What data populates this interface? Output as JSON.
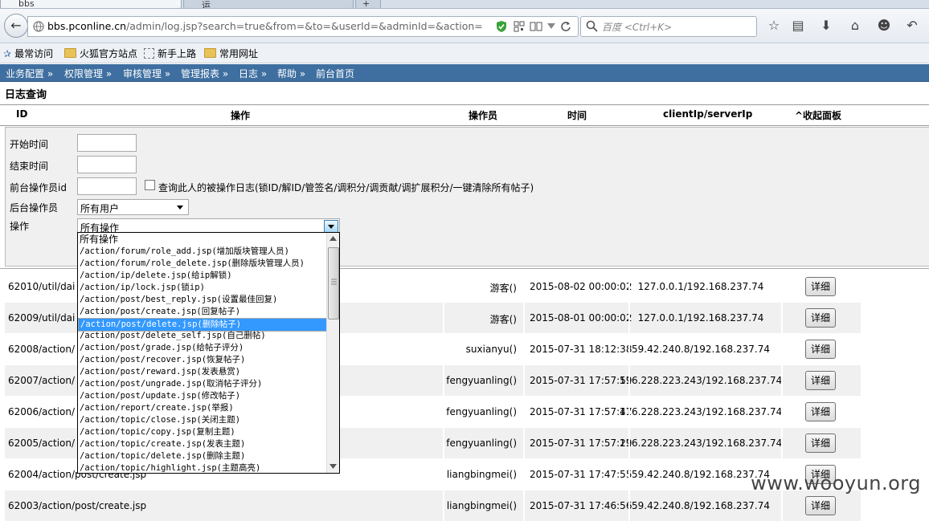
{
  "browser": {
    "tabs": [
      "bbs",
      "运",
      "+"
    ],
    "url_host": "bbs.pconline.cn",
    "url_path": "/admin/log.jsp?search=true&from=&to=&userId=&adminId=&action=",
    "search_placeholder": "百度 <Ctrl+K>"
  },
  "bookmarks": [
    "最常访问",
    "火狐官方站点",
    "新手上路",
    "常用网址"
  ],
  "menu": [
    "业务配置 »",
    "权限管理 »",
    "审核管理 »",
    "管理报表 »",
    "日志 »",
    "帮助 »",
    "前台首页"
  ],
  "page_title": "日志查询",
  "columns": [
    "ID",
    "操作",
    "操作员",
    "时间",
    "clientIp/serverIp",
    "^收起面板"
  ],
  "form": {
    "start_label": "开始时间",
    "end_label": "结束时间",
    "front_id_label": "前台操作员id",
    "checkbox_label": "查询此人的被操作日志(锁ID/解ID/管签名/调积分/调贡献/调扩展积分/一键清除所有帖子)",
    "admin_label": "后台操作员",
    "admin_value": "所有用户",
    "action_label": "操作",
    "action_value": "所有操作"
  },
  "action_options": [
    "所有操作",
    "/action/forum/role_add.jsp(增加版块管理人员)",
    "/action/forum/role_delete.jsp(删除版块管理人员)",
    "/action/ip/delete.jsp(给ip解锁)",
    "/action/ip/lock.jsp(锁ip)",
    "/action/post/best_reply.jsp(设置最佳回复)",
    "/action/post/create.jsp(回复帖子)",
    "/action/post/delete.jsp(删除帖子)",
    "/action/post/delete_self.jsp(自己删帖)",
    "/action/post/grade.jsp(给帖子评分)",
    "/action/post/recover.jsp(恢复帖子)",
    "/action/post/reward.jsp(发表悬赏)",
    "/action/post/ungrade.jsp(取消帖子评分)",
    "/action/post/update.jsp(修改帖子)",
    "/action/report/create.jsp(举报)",
    "/action/topic/close.jsp(关闭主题)",
    "/action/topic/copy.jsp(复制主题)",
    "/action/topic/create.jsp(发表主题)",
    "/action/topic/delete.jsp(删除主题)",
    "/action/topic/highlight.jsp(主题高亮)"
  ],
  "selected_option_index": 7,
  "detail_label": "详细",
  "rows": [
    {
      "id": "62010",
      "action": "/util/dai",
      "operator": "游客()",
      "time": "2015-08-02 00:00:02",
      "ip": "127.0.0.1/192.168.237.74"
    },
    {
      "id": "62009",
      "action": "/util/dai",
      "operator": "游客()",
      "time": "2015-08-01 00:00:02",
      "ip": "127.0.0.1/192.168.237.74"
    },
    {
      "id": "62008",
      "action": "/action/",
      "operator": "suxianyu()",
      "time": "2015-07-31 18:12:38",
      "ip": "59.42.240.8/192.168.237.74"
    },
    {
      "id": "62007",
      "action": "/action/",
      "operator": "fengyuanling()",
      "time": "2015-07-31 17:57:59",
      "ip": "116.228.223.243/192.168.237.74"
    },
    {
      "id": "62006",
      "action": "/action/",
      "operator": "fengyuanling()",
      "time": "2015-07-31 17:57:47",
      "ip": "116.228.223.243/192.168.237.74"
    },
    {
      "id": "62005",
      "action": "/action/",
      "operator": "fengyuanling()",
      "time": "2015-07-31 17:57:29",
      "ip": "116.228.223.243/192.168.237.74"
    },
    {
      "id": "62004",
      "action": "/action/post/create.jsp",
      "operator": "liangbingmei()",
      "time": "2015-07-31 17:47:55",
      "ip": "59.42.240.8/192.168.237.74"
    },
    {
      "id": "62003",
      "action": "/action/post/create.jsp",
      "operator": "liangbingmei()",
      "time": "2015-07-31 17:46:56",
      "ip": "59.42.240.8/192.168.237.74"
    }
  ],
  "watermark": "www.wooyun.org",
  "colors": {
    "menu_bg": "#3e6fa0",
    "highlight": "#3399ff",
    "row_alt": "#f0f0f0"
  }
}
